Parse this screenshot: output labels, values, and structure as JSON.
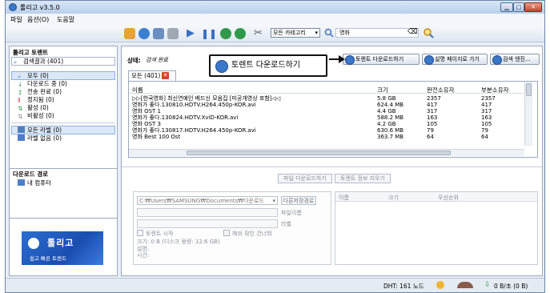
{
  "window": {
    "title": "툴리고 v3.5.0"
  },
  "menu": [
    "파일",
    "옵션(O)",
    "도움말"
  ],
  "toolbar": {
    "category": "모든 카테고리",
    "search_value": "영화"
  },
  "sidebar": {
    "torrents_header": "툴리고 토렌트",
    "search_results": "검색결과 (401)",
    "items": [
      "모두 (0)",
      "다운로드 중 (0)",
      "전송 완료 (0)",
      "정지됨 (0)",
      "활성 (0)",
      "비활성 (0)"
    ],
    "labels": [
      "모든 라벨 (0)",
      "라벨 없음 (0)"
    ],
    "download_path_header": "다운로드 경로",
    "my_computer": "내 컴퓨터",
    "ad_title": "툴리고",
    "ad_sub": "쉽고 빠른 토렌트"
  },
  "main": {
    "status_label": "상태:",
    "status_value": "검색 완료",
    "buttons": {
      "download": "토렌트 다운로드하기",
      "description": "설명 페이지로 가기",
      "search_engine": "검색 엔진..."
    },
    "callout": "토렌트 다운로드하기",
    "tab_label": "모든 (401)",
    "columns": [
      "이름",
      "크기",
      "완전소유자",
      "부분소유자"
    ],
    "rows": [
      [
        "▷▷[한국영화] 최신연예인 베드신 모음집 [미공개영상 포함]◁◁",
        "5.8 GB",
        "2357",
        "2357"
      ],
      [
        "영화가 좋다.130810.HDTV.H264.450p-KOR.avi",
        "624.4 MB",
        "417",
        "417"
      ],
      [
        "영화 OST 1",
        "4.4 GB",
        "317",
        "317"
      ],
      [
        "영화가 좋다.130824.HDTV.XviD-KOR.avi",
        "588.2 MB",
        "163",
        "163"
      ],
      [
        "영화 OST 3",
        "4.2 GB",
        "105",
        "105"
      ],
      [
        "영화가 좋다.130817.HDTV.H264.450p-KOR.avi",
        "630.6 MB",
        "79",
        "79"
      ],
      [
        "영화 Best 100 Ost",
        "363.7 MB",
        "64",
        "64"
      ]
    ]
  },
  "lower": {
    "file_download_btn": "파일 다운로드하기",
    "torrent_info_btn": "토렌트 정보 지우기",
    "path_value": "C:₩Users₩SAMSUNG₩Documents₩다운로드",
    "save_path_btn": "다른저장경로",
    "file_name_label": "파일이름",
    "label_label": "라벨",
    "start_torrent": "토렌트 시작",
    "skip_hash": "해쉬 확인 건너뛰",
    "size_info": "크기: 0 B (디스크 용량: 12.6 GB)",
    "desc_label": "설명:",
    "time_label": "시간:",
    "peer_columns": [
      "이름",
      "크기",
      "우선순위"
    ]
  },
  "statusbar": {
    "dht": "DHT: 161 노드",
    "speed": "0 B/초 (0 B)"
  }
}
